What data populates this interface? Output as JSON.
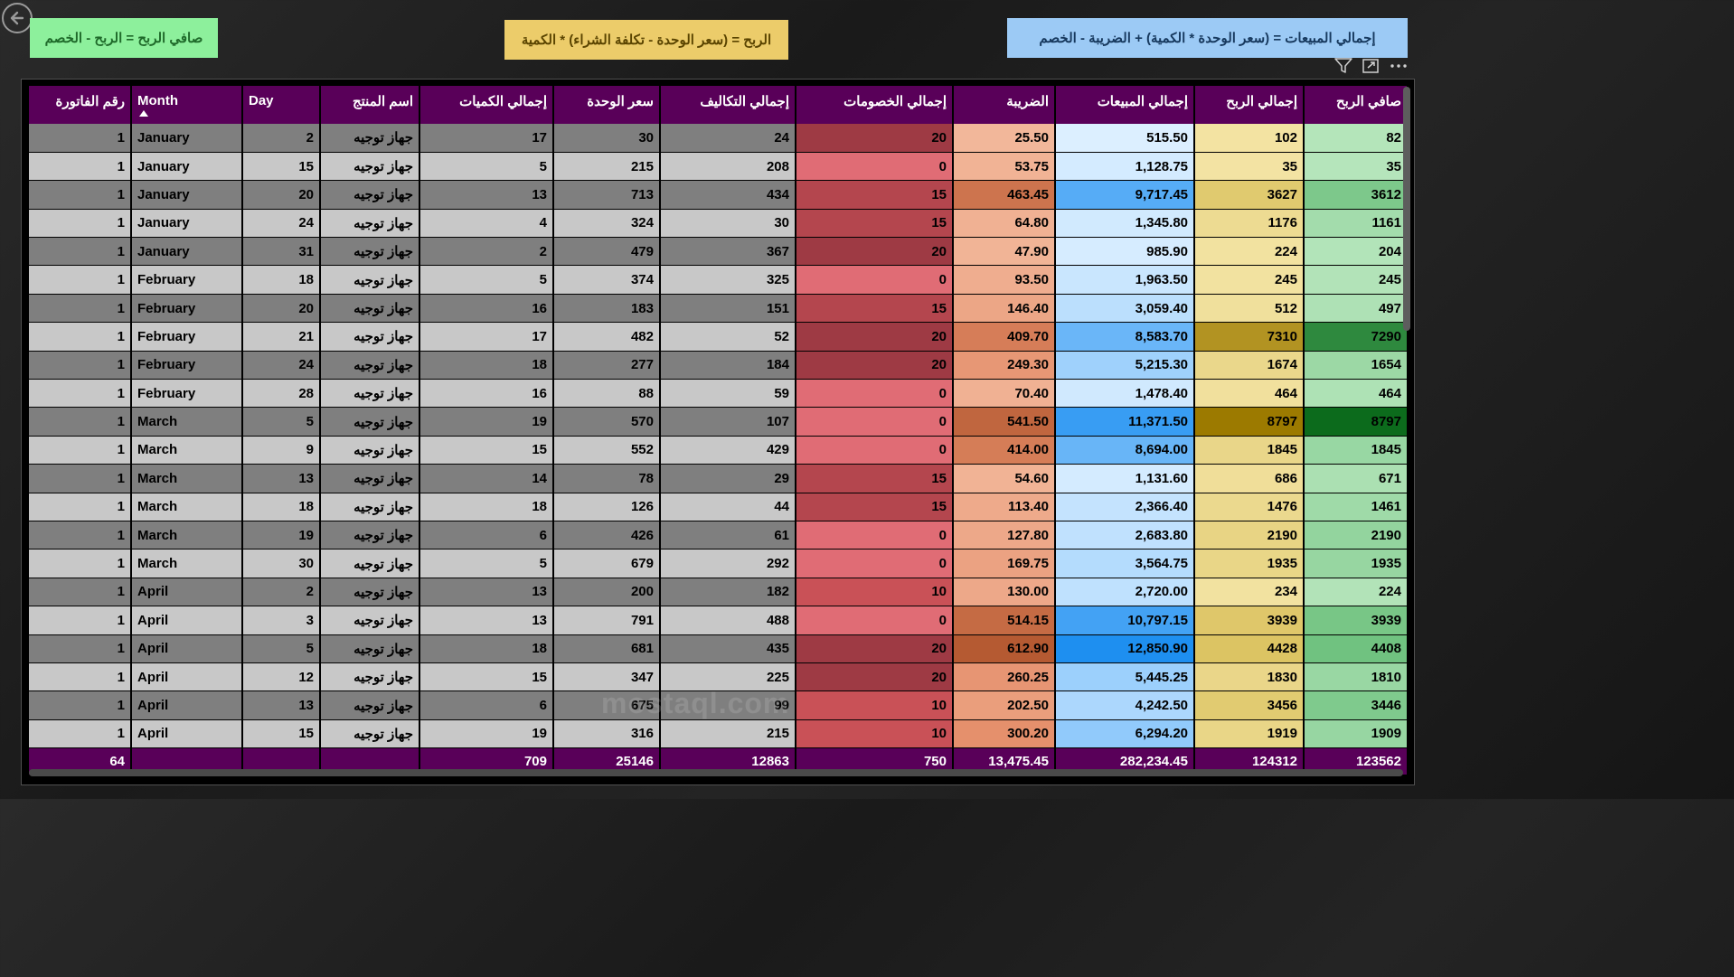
{
  "formulas": {
    "net_profit": "صافي الربح = الربح - الخصم",
    "profit": "الربح = (سعر الوحدة - تكلفة الشراء) * الكمية",
    "total_sales": "إجمالي المبيعات = (سعر الوحدة * الكمية) + الضريبة - الخصم"
  },
  "icons": [
    "back-arrow-icon",
    "filter-icon",
    "focus-mode-icon",
    "more-options-icon"
  ],
  "colors": {
    "header_bg": "#590059",
    "discount_scale": [
      "#e06c75",
      "#c95157",
      "#9e3a44"
    ],
    "tax_scale": [
      "#f2b79a",
      "#e48d69",
      "#b55a32"
    ],
    "sales_scale": [
      "#dcefff",
      "#8cc8fb",
      "#1e8ff0"
    ],
    "profit_scale": [
      "#f3e3a3",
      "#dcc463",
      "#9c7a00"
    ],
    "net_scale": [
      "#b5e5bb",
      "#70c280",
      "#0c6b1c"
    ]
  },
  "table": {
    "columns": [
      {
        "key": "invoice",
        "label": "رقم الفاتورة"
      },
      {
        "key": "month",
        "label": "Month"
      },
      {
        "key": "day",
        "label": "Day"
      },
      {
        "key": "product",
        "label": "اسم المنتج"
      },
      {
        "key": "qty",
        "label": "إجمالي الكميات"
      },
      {
        "key": "unit_price",
        "label": "سعر الوحدة"
      },
      {
        "key": "costs",
        "label": "إجمالي التكاليف"
      },
      {
        "key": "discounts",
        "label": "إجمالي الخصومات"
      },
      {
        "key": "tax",
        "label": "الضريبة"
      },
      {
        "key": "sales",
        "label": "إجمالي المبيعات"
      },
      {
        "key": "profit",
        "label": "إجمالي الربح"
      },
      {
        "key": "net",
        "label": "صافي الربح"
      }
    ],
    "sort_column": "Month",
    "rows": [
      [
        "1",
        "January",
        "2",
        "جهاز توجيه",
        "17",
        "30",
        "24",
        "20",
        "25.50",
        "515.50",
        "102",
        "82"
      ],
      [
        "1",
        "January",
        "15",
        "جهاز توجيه",
        "5",
        "215",
        "208",
        "0",
        "53.75",
        "1,128.75",
        "35",
        "35"
      ],
      [
        "1",
        "January",
        "20",
        "جهاز توجيه",
        "13",
        "713",
        "434",
        "15",
        "463.45",
        "9,717.45",
        "3627",
        "3612"
      ],
      [
        "1",
        "January",
        "24",
        "جهاز توجيه",
        "4",
        "324",
        "30",
        "15",
        "64.80",
        "1,345.80",
        "1176",
        "1161"
      ],
      [
        "1",
        "January",
        "31",
        "جهاز توجيه",
        "2",
        "479",
        "367",
        "20",
        "47.90",
        "985.90",
        "224",
        "204"
      ],
      [
        "1",
        "February",
        "18",
        "جهاز توجيه",
        "5",
        "374",
        "325",
        "0",
        "93.50",
        "1,963.50",
        "245",
        "245"
      ],
      [
        "1",
        "February",
        "20",
        "جهاز توجيه",
        "16",
        "183",
        "151",
        "15",
        "146.40",
        "3,059.40",
        "512",
        "497"
      ],
      [
        "1",
        "February",
        "21",
        "جهاز توجيه",
        "17",
        "482",
        "52",
        "20",
        "409.70",
        "8,583.70",
        "7310",
        "7290"
      ],
      [
        "1",
        "February",
        "24",
        "جهاز توجيه",
        "18",
        "277",
        "184",
        "20",
        "249.30",
        "5,215.30",
        "1674",
        "1654"
      ],
      [
        "1",
        "February",
        "28",
        "جهاز توجيه",
        "16",
        "88",
        "59",
        "0",
        "70.40",
        "1,478.40",
        "464",
        "464"
      ],
      [
        "1",
        "March",
        "5",
        "جهاز توجيه",
        "19",
        "570",
        "107",
        "0",
        "541.50",
        "11,371.50",
        "8797",
        "8797"
      ],
      [
        "1",
        "March",
        "9",
        "جهاز توجيه",
        "15",
        "552",
        "429",
        "0",
        "414.00",
        "8,694.00",
        "1845",
        "1845"
      ],
      [
        "1",
        "March",
        "13",
        "جهاز توجيه",
        "14",
        "78",
        "29",
        "15",
        "54.60",
        "1,131.60",
        "686",
        "671"
      ],
      [
        "1",
        "March",
        "18",
        "جهاز توجيه",
        "18",
        "126",
        "44",
        "15",
        "113.40",
        "2,366.40",
        "1476",
        "1461"
      ],
      [
        "1",
        "March",
        "19",
        "جهاز توجيه",
        "6",
        "426",
        "61",
        "0",
        "127.80",
        "2,683.80",
        "2190",
        "2190"
      ],
      [
        "1",
        "March",
        "30",
        "جهاز توجيه",
        "5",
        "679",
        "292",
        "0",
        "169.75",
        "3,564.75",
        "1935",
        "1935"
      ],
      [
        "1",
        "April",
        "2",
        "جهاز توجيه",
        "13",
        "200",
        "182",
        "10",
        "130.00",
        "2,720.00",
        "234",
        "224"
      ],
      [
        "1",
        "April",
        "3",
        "جهاز توجيه",
        "13",
        "791",
        "488",
        "0",
        "514.15",
        "10,797.15",
        "3939",
        "3939"
      ],
      [
        "1",
        "April",
        "5",
        "جهاز توجيه",
        "18",
        "681",
        "435",
        "20",
        "612.90",
        "12,850.90",
        "4428",
        "4408"
      ],
      [
        "1",
        "April",
        "12",
        "جهاز توجيه",
        "15",
        "347",
        "225",
        "20",
        "260.25",
        "5,445.25",
        "1830",
        "1810"
      ],
      [
        "1",
        "April",
        "13",
        "جهاز توجيه",
        "6",
        "675",
        "99",
        "10",
        "202.50",
        "4,242.50",
        "3456",
        "3446"
      ],
      [
        "1",
        "April",
        "15",
        "جهاز توجيه",
        "19",
        "316",
        "215",
        "10",
        "300.20",
        "6,294.20",
        "1919",
        "1909"
      ]
    ],
    "totals": [
      "64",
      "",
      "",
      "",
      "709",
      "25146",
      "12863",
      "750",
      "13,475.45",
      "282,234.45",
      "124312",
      "123562"
    ]
  },
  "watermark": "mostaql.com"
}
